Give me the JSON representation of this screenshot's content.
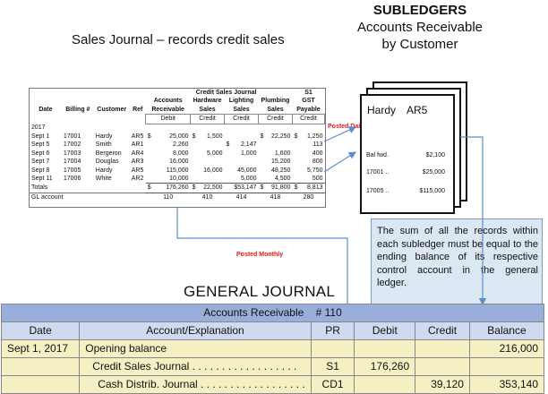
{
  "sales_journal_title": "Sales Journal – records credit sales",
  "subledgers": {
    "heading": "SUBLEDGERS",
    "line1": "Accounts Receivable",
    "line2": "by Customer"
  },
  "csj": {
    "title": "Credit Sales Journal",
    "page": "S1",
    "headers": {
      "date": "Date",
      "billing": "Billing #",
      "customer": "Customer",
      "ref": "Ref",
      "ar1": "Accounts",
      "ar2": "Receivable",
      "hw1": "Hardware",
      "hw2": "Sales",
      "li1": "Lighting",
      "li2": "Sales",
      "pl1": "Plumbing",
      "pl2": "Sales",
      "gst1": "GST",
      "gst2": "Payable"
    },
    "dc": {
      "ar": "Debit",
      "hw": "Credit",
      "li": "Credit",
      "pl": "Credit",
      "gst": "Credit"
    },
    "year": "2017",
    "rows": [
      {
        "date": "Sept 1",
        "billing": "17001",
        "customer": "Hardy",
        "ref": "AR5",
        "ar_s": "$",
        "ar": "25,000",
        "hw_s": "$",
        "hw": "1,500",
        "li_s": "",
        "li": "",
        "pl_s": "$",
        "pl": "22,250",
        "gst_s": "$",
        "gst": "1,250"
      },
      {
        "date": "Sept 5",
        "billing": "17002",
        "customer": "Smith",
        "ref": "AR1",
        "ar_s": "",
        "ar": "2,260",
        "hw_s": "",
        "hw": "",
        "li_s": "$",
        "li": "2,147",
        "pl_s": "",
        "pl": "",
        "gst_s": "",
        "gst": "113"
      },
      {
        "date": "Sept 6",
        "billing": "17003",
        "customer": "Bergeron",
        "ref": "AR4",
        "ar_s": "",
        "ar": "8,000",
        "hw_s": "",
        "hw": "5,000",
        "li_s": "",
        "li": "1,000",
        "pl_s": "",
        "pl": "1,600",
        "gst_s": "",
        "gst": "400"
      },
      {
        "date": "Sept 7",
        "billing": "17004",
        "customer": "Douglas",
        "ref": "AR3",
        "ar_s": "",
        "ar": "16,000",
        "hw_s": "",
        "hw": "",
        "li_s": "",
        "li": "",
        "pl_s": "",
        "pl": "15,200",
        "gst_s": "",
        "gst": "800"
      },
      {
        "date": "Sept 8",
        "billing": "17005",
        "customer": "Hardy",
        "ref": "AR5",
        "ar_s": "",
        "ar": "115,000",
        "hw_s": "",
        "hw": "16,000",
        "li_s": "",
        "li": "45,000",
        "pl_s": "",
        "pl": "48,250",
        "gst_s": "",
        "gst": "5,750"
      },
      {
        "date": "Sept 11",
        "billing": "17006",
        "customer": "White",
        "ref": "AR2",
        "ar_s": "",
        "ar": "10,000",
        "hw_s": "",
        "hw": "",
        "li_s": "",
        "li": "5,000",
        "pl_s": "",
        "pl": "4,500",
        "gst_s": "",
        "gst": "500"
      }
    ],
    "totals": {
      "label": "Totals",
      "ar_s": "$",
      "ar": "176,260",
      "hw_s": "$",
      "hw": "22,500",
      "li": "$53,147",
      "pl_s": "$",
      "pl": "91,800",
      "gst_s": "$",
      "gst": "8,813"
    },
    "gl": {
      "label": "GL account",
      "ar": "110",
      "hw": "410",
      "li": "414",
      "pl": "418",
      "gst": "280"
    }
  },
  "posted_daily": "Posted Daily",
  "posted_monthly": "Posted Monthly",
  "ledger_card": {
    "customer": "Hardy",
    "account": "AR5",
    "rows": [
      {
        "label": "Bal fwd.",
        "value": "$2,100"
      },
      {
        "label": "17001 ..",
        "value": "$25,000"
      },
      {
        "label": "17005 ..",
        "value": "$115,000"
      }
    ]
  },
  "callout_text": "The sum of all the records within each subledger must be equal to the ending balance of its respective control account in the general ledger.",
  "gj": {
    "title": "GENERAL JOURNAL",
    "account_bar": "Accounts Receivable    # 110",
    "headers": {
      "date": "Date",
      "account": "Account/Explanation",
      "pr": "PR",
      "debit": "Debit",
      "credit": "Credit",
      "balance": "Balance"
    },
    "rows": [
      {
        "date": "Sept 1, 2017",
        "account": "Opening balance",
        "pr": "",
        "debit": "",
        "credit": "",
        "balance": "216,000"
      },
      {
        "date": "",
        "account": "Credit Sales Journal . . . . . . . . . . . . . . . . . .",
        "pr": "S1",
        "debit": "176,260",
        "credit": "",
        "balance": ""
      },
      {
        "date": "",
        "account": "Cash Distrib. Journal . . . . . . . . . . . . . . . . . .",
        "pr": "CD1",
        "debit": "",
        "credit": "39,120",
        "balance": "353,140"
      }
    ]
  },
  "colors": {
    "accent_red": "#e0141b",
    "arrow_blue": "#5b8fc9",
    "callout_bg": "#dbe7f2",
    "gj_bar": "#9aaedc",
    "gj_header": "#cfd9ef",
    "gj_rows": "#f5f0c4"
  }
}
